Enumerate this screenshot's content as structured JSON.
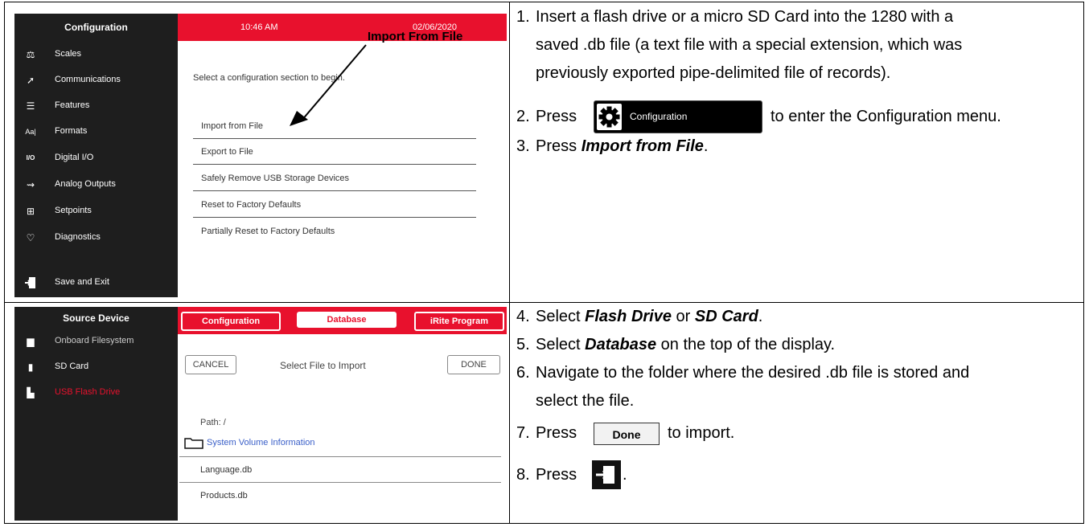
{
  "panel1": {
    "sidebar_title": "Configuration",
    "sidebar_items": [
      {
        "icon": "scales-icon",
        "label": "Scales"
      },
      {
        "icon": "communications-icon",
        "label": "Communications"
      },
      {
        "icon": "features-icon",
        "label": "Features"
      },
      {
        "icon": "formats-icon",
        "label": "Formats"
      },
      {
        "icon": "digital-io-icon",
        "label": "Digital I/O"
      },
      {
        "icon": "analog-outputs-icon",
        "label": "Analog Outputs"
      },
      {
        "icon": "setpoints-icon",
        "label": "Setpoints"
      },
      {
        "icon": "diagnostics-icon",
        "label": "Diagnostics"
      }
    ],
    "save_exit": "Save and Exit",
    "time": "10:46 AM",
    "date": "02/06/2020",
    "prompt": "Select a configuration section to begin.",
    "menu": [
      "Import from File",
      "Export to File",
      "Safely Remove USB Storage Devices",
      "Reset to Factory Defaults",
      "Partially Reset to Factory Defaults"
    ],
    "callout": "Import From File"
  },
  "panel2": {
    "sidebar_title": "Source Device",
    "sources": [
      {
        "icon": "onboard-filesystem-icon",
        "label": "Onboard Filesystem",
        "selected": false
      },
      {
        "icon": "sd-card-icon",
        "label": "SD Card",
        "selected": false
      },
      {
        "icon": "usb-drive-icon",
        "label": "USB Flash Drive",
        "selected": true
      }
    ],
    "tabs": [
      "Configuration",
      "Database",
      "iRite Program"
    ],
    "active_tab": "Database",
    "cancel": "CANCEL",
    "heading": "Select File to Import",
    "done": "DONE",
    "path": "Path: /",
    "folder": "System Volume Information",
    "files": [
      "Language.db",
      "Products.db"
    ]
  },
  "instructions": {
    "s1_num": "1.",
    "s1_l1": "Insert a flash drive or a micro SD Card into the 1280 with a",
    "s1_l2": "saved .db file (a text file with a special extension, which was",
    "s1_l3": "previously exported pipe-delimited file of records).",
    "s2_num": "2.",
    "s2_press": "Press",
    "s2_button": "Configuration",
    "s2_after": "to enter the Configuration menu.",
    "s3_num": "3.",
    "s3_press": "Press ",
    "s3_target": "Import from File",
    "s3_end": ".",
    "s4_num": "4.",
    "s4_pre": "Select ",
    "s4_a": "Flash Drive",
    "s4_mid": " or ",
    "s4_b": "SD Card",
    "s4_end": ".",
    "s5_num": "5.",
    "s5_pre": "Select ",
    "s5_target": "Database",
    "s5_end": " on the top of the display.",
    "s6_num": "6.",
    "s6_l1": "Navigate to the folder where the desired .db file is stored and",
    "s6_l2": "select the file.",
    "s7_num": "7.",
    "s7_press": "Press",
    "s7_button": "Done",
    "s7_after": "to import.",
    "s8_num": "8.",
    "s8_press": "Press",
    "s8_end": "."
  },
  "colors": {
    "accent_red": "#e8112d",
    "sidebar_dark": "#1e1e1e",
    "link_blue": "#3a5fc8"
  }
}
